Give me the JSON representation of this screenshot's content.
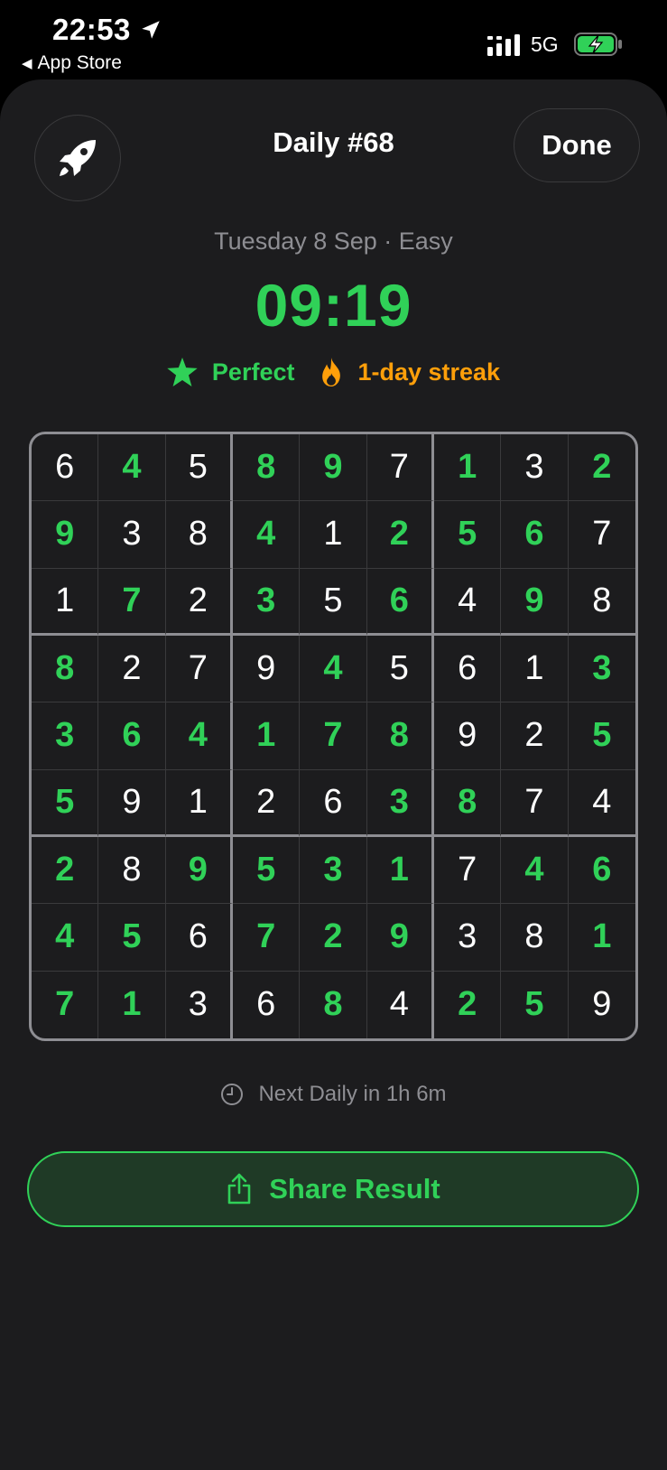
{
  "status_bar": {
    "time": "22:53",
    "back_label": "App Store",
    "network": "5G"
  },
  "header": {
    "title": "Daily #68",
    "done_label": "Done"
  },
  "info": {
    "subtitle": "Tuesday 8 Sep · Easy",
    "timer": "09:19",
    "perfect_label": "Perfect",
    "streak_label": "1-day streak"
  },
  "board": {
    "rows": [
      [
        "6",
        "4",
        "5",
        "8",
        "9",
        "7",
        "1",
        "3",
        "2"
      ],
      [
        "9",
        "3",
        "8",
        "4",
        "1",
        "2",
        "5",
        "6",
        "7"
      ],
      [
        "1",
        "7",
        "2",
        "3",
        "5",
        "6",
        "4",
        "9",
        "8"
      ],
      [
        "8",
        "2",
        "7",
        "9",
        "4",
        "5",
        "6",
        "1",
        "3"
      ],
      [
        "3",
        "6",
        "4",
        "1",
        "7",
        "8",
        "9",
        "2",
        "5"
      ],
      [
        "5",
        "9",
        "1",
        "2",
        "6",
        "3",
        "8",
        "7",
        "4"
      ],
      [
        "2",
        "8",
        "9",
        "5",
        "3",
        "1",
        "7",
        "4",
        "6"
      ],
      [
        "4",
        "5",
        "6",
        "7",
        "2",
        "9",
        "3",
        "8",
        "1"
      ],
      [
        "7",
        "1",
        "3",
        "6",
        "8",
        "4",
        "2",
        "5",
        "9"
      ]
    ],
    "filled_by_player": [
      [
        0,
        1,
        0,
        1,
        1,
        0,
        1,
        0,
        1
      ],
      [
        1,
        0,
        0,
        1,
        0,
        1,
        1,
        1,
        0
      ],
      [
        0,
        1,
        0,
        1,
        0,
        1,
        0,
        1,
        0
      ],
      [
        1,
        0,
        0,
        0,
        1,
        0,
        0,
        0,
        1
      ],
      [
        1,
        1,
        1,
        1,
        1,
        1,
        0,
        0,
        1
      ],
      [
        1,
        0,
        0,
        0,
        0,
        1,
        1,
        0,
        0
      ],
      [
        1,
        0,
        1,
        1,
        1,
        1,
        0,
        1,
        1
      ],
      [
        1,
        1,
        0,
        1,
        1,
        1,
        0,
        0,
        1
      ],
      [
        1,
        1,
        0,
        0,
        1,
        0,
        1,
        1,
        0
      ]
    ]
  },
  "footer": {
    "next_daily": "Next Daily in 1h 6m",
    "share_label": "Share Result"
  },
  "colors": {
    "accent": "#30d158",
    "streak": "#ff9f0a",
    "background": "#1c1c1e"
  },
  "icons": [
    "location-arrow-icon",
    "signal-icon",
    "battery-charging-icon",
    "rocket-icon",
    "star-icon",
    "flame-icon",
    "clock-icon",
    "share-icon"
  ]
}
